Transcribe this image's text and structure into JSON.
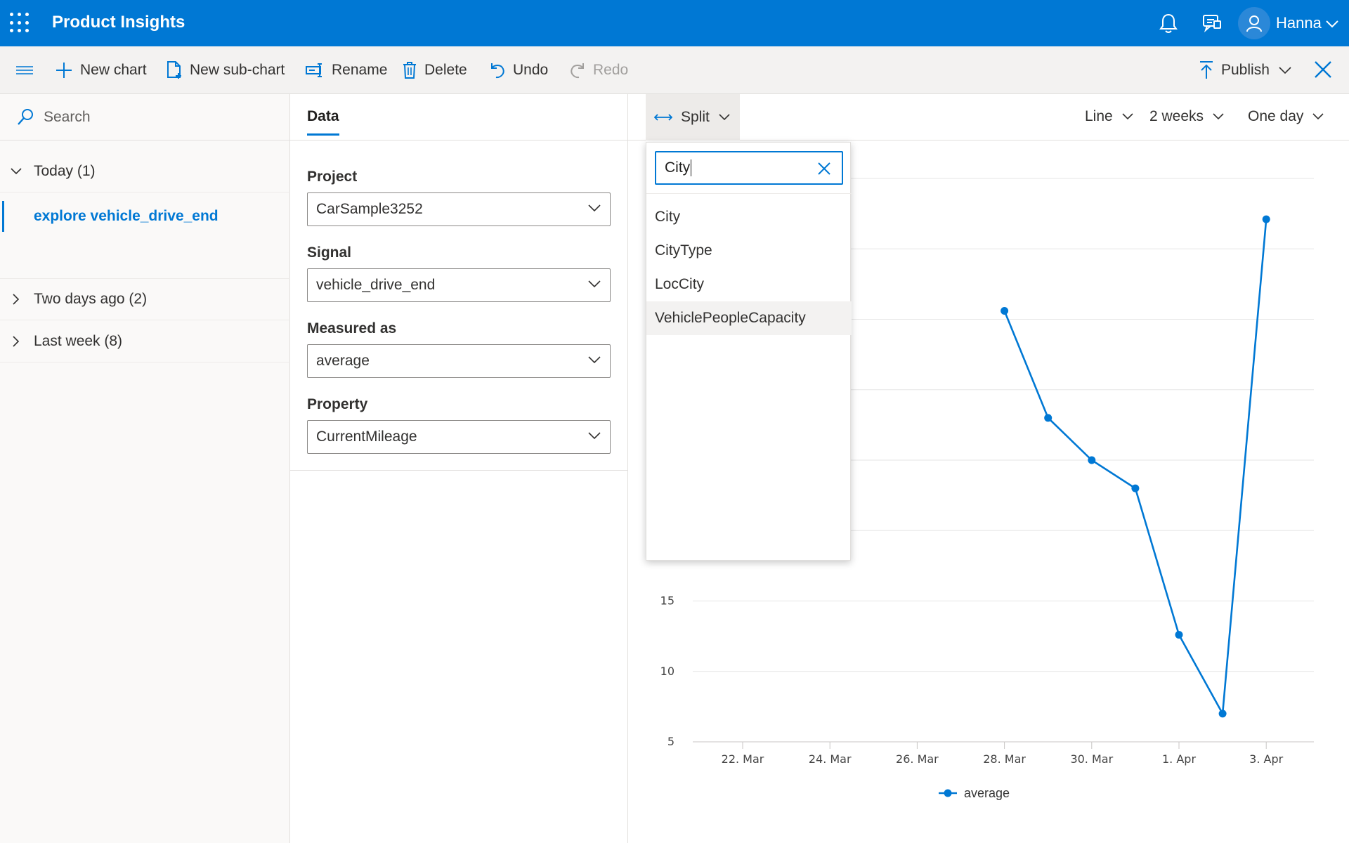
{
  "app": {
    "title": "Product Insights",
    "user": "Hanna"
  },
  "commands": {
    "new_chart": "New chart",
    "new_subchart": "New sub-chart",
    "rename": "Rename",
    "delete": "Delete",
    "undo": "Undo",
    "redo": "Redo",
    "publish": "Publish"
  },
  "history": {
    "search_placeholder": "Search",
    "groups": [
      {
        "label": "Today (1)",
        "expanded": true,
        "items": [
          "explore vehicle_drive_end"
        ]
      },
      {
        "label": "Two days ago (2)",
        "expanded": false
      },
      {
        "label": "Last week (8)",
        "expanded": false
      }
    ]
  },
  "data_panel": {
    "tab": "Data",
    "fields": [
      {
        "label": "Project",
        "value": "CarSample3252"
      },
      {
        "label": "Signal",
        "value": "vehicle_drive_end"
      },
      {
        "label": "Measured as",
        "value": "average"
      },
      {
        "label": "Property",
        "value": "CurrentMileage"
      }
    ]
  },
  "chart_toolbar": {
    "split": "Split",
    "chart_type": "Line",
    "range": "2 weeks",
    "granularity": "One day"
  },
  "split_popup": {
    "query": "City",
    "options": [
      "City",
      "CityType",
      "LocCity",
      "VehiclePeopleCapacity"
    ],
    "highlighted": "VehiclePeopleCapacity"
  },
  "chart_data": {
    "type": "line",
    "x_ticks": [
      "22. Mar",
      "24. Mar",
      "26. Mar",
      "28. Mar",
      "30. Mar",
      "1. Apr",
      "3. Apr"
    ],
    "y_ticks_visible": [
      5,
      10,
      15
    ],
    "ylim": [
      5,
      45
    ],
    "grid": true,
    "legend_position": "bottom",
    "series": [
      {
        "name": "average",
        "color": "#0078d4",
        "points": [
          {
            "x": "28. Mar",
            "y": 35.6
          },
          {
            "x": "29. Mar",
            "y": 28.0
          },
          {
            "x": "30. Mar",
            "y": 25.0
          },
          {
            "x": "31. Mar",
            "y": 23.0
          },
          {
            "x": "1. Apr",
            "y": 12.6
          },
          {
            "x": "2. Apr",
            "y": 7.0
          },
          {
            "x": "3. Apr",
            "y": 42.1
          }
        ]
      }
    ]
  }
}
